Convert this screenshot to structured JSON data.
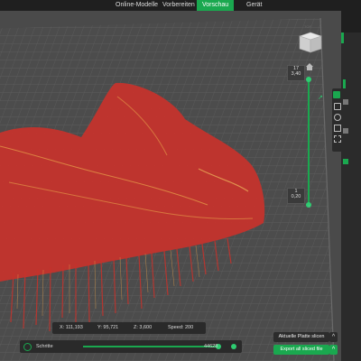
{
  "topbar": {
    "tabs": [
      {
        "label": "Online-Modelle"
      },
      {
        "label": "Vorbereiten"
      },
      {
        "label": "Vorschau",
        "active": true
      },
      {
        "label": "Gerät"
      }
    ]
  },
  "viewcube": {
    "label": "TOP"
  },
  "layer_slider": {
    "top_layer": "17",
    "top_height": "3,40",
    "bottom_layer": "1",
    "bottom_height": "0,20"
  },
  "coords": {
    "x": "X: 111,193",
    "y": "Y: 95,721",
    "z": "Z: 3,600",
    "speed": "Speed: 200"
  },
  "moves": {
    "label": "Schritte",
    "value": "44628"
  },
  "buttons": {
    "slice_plate": "Aktuelle Platte slicen",
    "export_all": "Export all sliced file",
    "chevron": "^"
  },
  "colors": {
    "accent": "#1aa84f",
    "toolpath": "#c8322b",
    "plate": "#4a4a4a"
  }
}
